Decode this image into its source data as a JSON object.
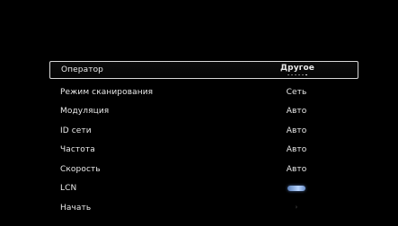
{
  "menu": {
    "items": [
      {
        "label": "Оператор",
        "value": "Другое"
      },
      {
        "label": "Режим сканирования",
        "value": "Сеть"
      },
      {
        "label": "Модуляция",
        "value": "Авто"
      },
      {
        "label": "ID сети",
        "value": "Авто"
      },
      {
        "label": "Частота",
        "value": "Авто"
      },
      {
        "label": "Скорость",
        "value": "Авто"
      },
      {
        "label": "LCN",
        "value": ""
      },
      {
        "label": "Начать",
        "value": ""
      }
    ]
  },
  "icons": {
    "lcn_state": "toggle-icon",
    "start_action": "chevron-right-icon"
  },
  "colors": {
    "background": "#000000",
    "text": "#e9e9e9",
    "selection_border": "#d9d9d9",
    "toggle_accent": "#b7d4ff"
  }
}
